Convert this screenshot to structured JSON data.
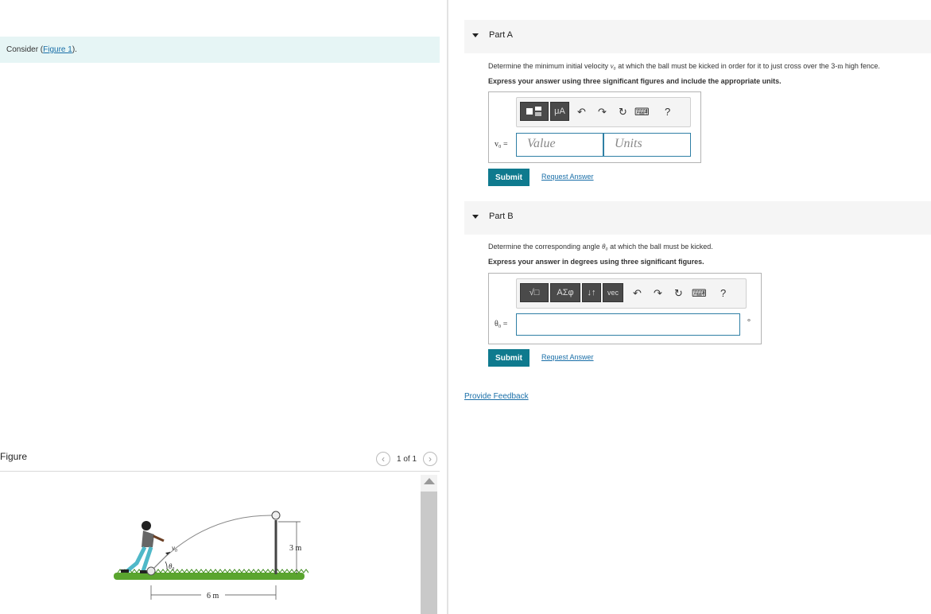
{
  "problem": {
    "consider_prefix": "Consider (",
    "figure_link": "Figure 1",
    "consider_suffix": ")."
  },
  "figure_panel": {
    "title": "Figure",
    "pagination": "1 of 1",
    "labels": {
      "v0": "v₀",
      "theta0": "θ₀",
      "height": "3 m",
      "distance": "6 m"
    }
  },
  "part_a": {
    "label": "Part A",
    "question_pre": "Determine the minimum initial velocity ",
    "question_var": "v₀",
    "question_post": " at which the ball must be kicked in order for it to just cross over the 3-",
    "question_unit": "m",
    "question_end": " high fence.",
    "instruction": "Express your answer using three significant figures and include the appropriate units.",
    "toolbar": {
      "templates": "",
      "units_btn": "μA",
      "undo": "↶",
      "redo": "↷",
      "reset": "↻",
      "keyboard": "⌨",
      "help": "?"
    },
    "var_label": "v₀ =",
    "value_placeholder": "Value",
    "units_placeholder": "Units",
    "submit": "Submit",
    "request": "Request Answer"
  },
  "part_b": {
    "label": "Part B",
    "question_pre": "Determine the corresponding angle ",
    "question_var": "θ₀",
    "question_post": " at which the ball must be kicked.",
    "instruction": "Express your answer in degrees using three significant figures.",
    "toolbar": {
      "templates": "√□",
      "greek": "ΑΣφ",
      "arrows": "↓↑",
      "vec": "vec",
      "undo": "↶",
      "redo": "↷",
      "reset": "↻",
      "keyboard": "⌨",
      "help": "?"
    },
    "var_label": "θ₀ =",
    "answer_value": "",
    "unit_symbol": "°",
    "submit": "Submit",
    "request": "Request Answer"
  },
  "feedback": "Provide Feedback",
  "colors": {
    "accent": "#0f7a8e",
    "link": "#1a6fa8",
    "consider_bg": "#e6f5f5",
    "grass": "#5aa52e"
  }
}
